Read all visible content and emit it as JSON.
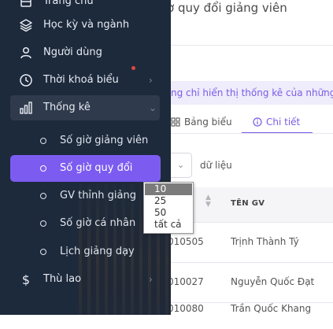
{
  "header": {
    "title": "ờ quy đổi giảng viên"
  },
  "notice": {
    "text": "ng chỉ hiển thị thống kê của những"
  },
  "tabs": [
    {
      "label": "Bảng biểu",
      "icon": "grid-icon"
    },
    {
      "label": "Chi tiết",
      "icon": "info-icon"
    }
  ],
  "sidebar": {
    "items": [
      {
        "label": "Trang chủ",
        "icon": "home-icon"
      },
      {
        "label": "Học kỳ và ngành",
        "icon": "layers-icon"
      },
      {
        "label": "Người dùng",
        "icon": "user-icon"
      },
      {
        "label": "Thời khoá biểu",
        "icon": "clock-icon",
        "arrow": "›"
      },
      {
        "label": "Thống kê",
        "icon": "bar-chart-icon",
        "arrow": "⌄"
      },
      {
        "label": "Thù lao",
        "icon": "dollar-icon",
        "arrow": "›"
      }
    ],
    "subitems": [
      {
        "label": "Số giờ giảng viên"
      },
      {
        "label": "Số giờ quy đổi"
      },
      {
        "label": "GV thỉnh giảng"
      },
      {
        "label": "Số giờ cá nhân"
      },
      {
        "label": "Lịch giảng dạy"
      }
    ]
  },
  "page_size": {
    "options": [
      "10",
      "25",
      "50",
      "tất cả"
    ],
    "selected": "10",
    "suffix_label": "dữ liệu"
  },
  "table": {
    "header_name": "TÊN GV",
    "rows": [
      {
        "code": "010505",
        "name": "Trịnh Thành Tý"
      },
      {
        "code": "010027",
        "name": "Nguyễn Quốc Đạt"
      },
      {
        "code": "010080",
        "name": "Trần Quốc Khang"
      }
    ]
  },
  "colors": {
    "accent": "#7c5cf0",
    "sidebar": "#1d2a3c",
    "notification": "#e0473d"
  }
}
